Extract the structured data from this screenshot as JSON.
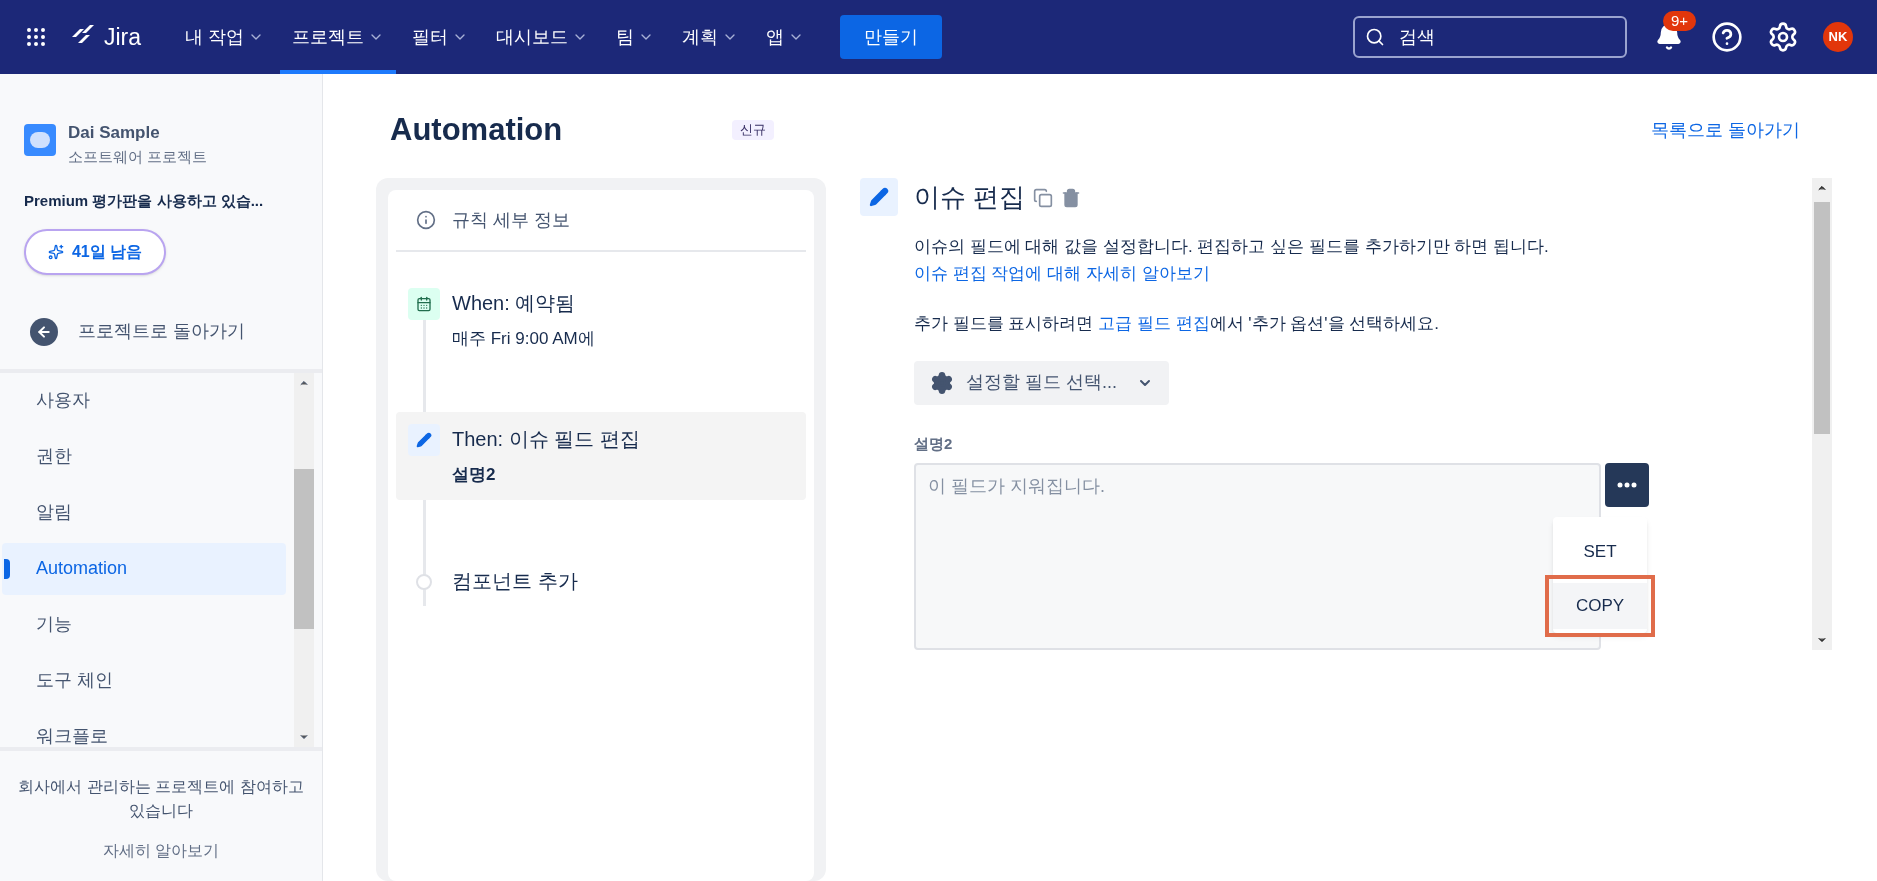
{
  "top_nav": {
    "logo": "Jira",
    "menus": [
      {
        "label": "내 작업",
        "selected": false
      },
      {
        "label": "프로젝트",
        "selected": true
      },
      {
        "label": "필터",
        "selected": false
      },
      {
        "label": "대시보드",
        "selected": false
      },
      {
        "label": "팀",
        "selected": false
      },
      {
        "label": "계획",
        "selected": false
      },
      {
        "label": "앱",
        "selected": false
      }
    ],
    "create_button": "만들기",
    "search": {
      "placeholder": "검색"
    },
    "notification_badge": "9+",
    "avatar": "NK"
  },
  "sidebar": {
    "project_name": "Dai Sample",
    "project_type": "소프트웨어 프로젝트",
    "trial_text": "Premium 평가판을 사용하고 있습...",
    "days_button": "41일 남음",
    "back_link": "프로젝트로 돌아가기",
    "items": [
      {
        "label": "사용자",
        "selected": false
      },
      {
        "label": "권한",
        "selected": false
      },
      {
        "label": "알림",
        "selected": false
      },
      {
        "label": "Automation",
        "selected": true
      },
      {
        "label": "기능",
        "selected": false
      },
      {
        "label": "도구 체인",
        "selected": false
      },
      {
        "label": "워크플로",
        "selected": false
      }
    ],
    "footer_text": "회사에서 관리하는 프로젝트에 참여하고 있습니다",
    "footer_link": "자세히 알아보기"
  },
  "page": {
    "title": "Automation",
    "badge": "신규",
    "back_link": "목록으로 돌아가기"
  },
  "rule": {
    "details": "규칙 세부 정보",
    "steps": [
      {
        "kind": "trigger",
        "title": "When: 예약됨",
        "subtitle": "매주 Fri 9:00 AM에",
        "selected": false
      },
      {
        "kind": "action",
        "title": "Then: 이슈 필드 편집",
        "subtitle": "설명2",
        "selected": true
      },
      {
        "kind": "add",
        "title": "컴포넌트 추가",
        "selected": false
      }
    ]
  },
  "editor": {
    "title": "이슈 편집",
    "description": "이슈의 필드에 대해 값을 설정합니다. 편집하고 싶은 필드를 추가하기만 하면 됩니다.",
    "description_link": "이슈 편집 작업에 대해 자세히 알아보기",
    "hint_before": "추가 필드를 표시하려면",
    "hint_link": "고급 필드 편집",
    "hint_after": "에서 '추가 옵션'을 선택하세요.",
    "field_select": "설정할 필드 선택...",
    "field_label": "설명2",
    "field_placeholder": "이 필드가 지워집니다.",
    "menu": [
      {
        "label": "SET",
        "highlighted": false
      },
      {
        "label": "COPY",
        "highlighted": true
      }
    ]
  }
}
